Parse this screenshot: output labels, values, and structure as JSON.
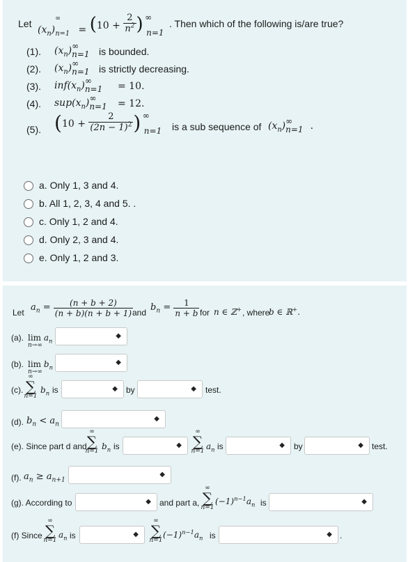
{
  "q1": {
    "intro_let": "Let",
    "intro_then": ". Then which of the following is/are true?",
    "statements": [
      {
        "num": "(1).",
        "text": "is bounded."
      },
      {
        "num": "(2).",
        "text": "is strictly decreasing."
      },
      {
        "num": "(3).",
        "text": "= 10."
      },
      {
        "num": "(4).",
        "text": "= 12."
      },
      {
        "num": "(5).",
        "text": "is a sub sequence of"
      }
    ],
    "options": [
      "a. Only 1, 3 and 4.",
      "b. All 1, 2, 3, 4 and 5. .",
      "c. Only 1, 2 and 4.",
      "d. Only 2, 3 and 4.",
      "e. Only 1, 2 and 3."
    ]
  },
  "q2": {
    "let": "Let",
    "and": "and",
    "for_text": "for",
    "where": ", where",
    "a_label": "(a).",
    "b_label": "(b).",
    "c_label": "(c).",
    "c_is": "is",
    "by": "by",
    "test": "test.",
    "d_label": "(d).",
    "e_label": "(e). Since part d and",
    "e_is": "is",
    "e_is2": "is",
    "f_label": "(f).",
    "g_label": "(g). According to",
    "g_and": "and part a,",
    "g_is": "is",
    "h_label": "(f) Since",
    "h_is": "is",
    "h_is2": "is",
    "select_arrow": "◆"
  }
}
